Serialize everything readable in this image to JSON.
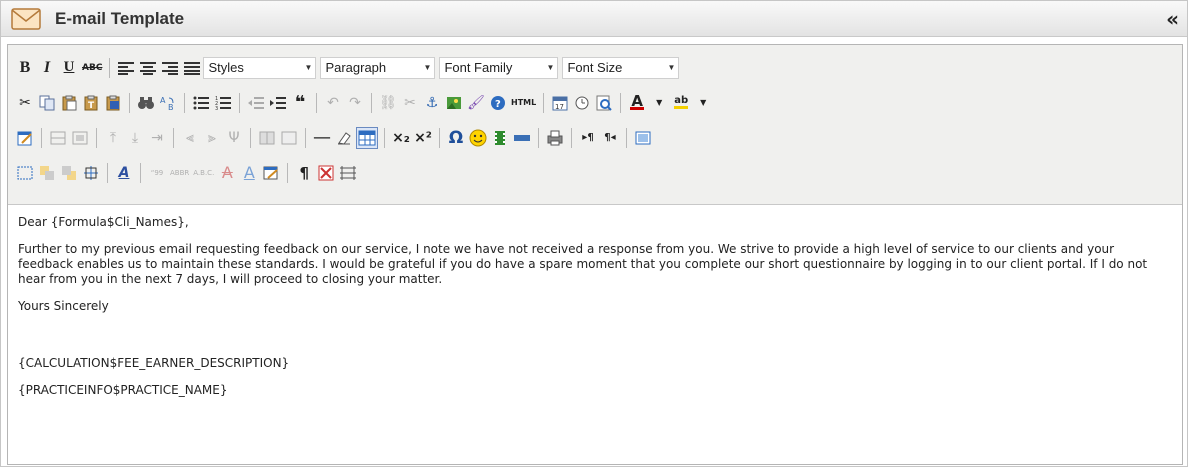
{
  "window": {
    "title": "E-mail Template",
    "collapse_glyph": "«"
  },
  "toolbar": {
    "bold": "B",
    "italic": "I",
    "underline": "U",
    "strikethrough": "ABC",
    "styles": "Styles",
    "paragraph": "Paragraph",
    "font_family": "Font Family",
    "font_size": "Font Size",
    "blockquote": "❝",
    "html": "HTML",
    "font_color": "A",
    "highlight": "ab",
    "subscript": "×₂",
    "superscript": "×²",
    "omega": "Ω",
    "smiley": "☺",
    "print": "⎙",
    "abbr": "ABBR",
    "acronym": "A.B.C.",
    "quote": "“99",
    "pilcrow": "¶",
    "ltr": "▸¶",
    "rtl": "¶◂"
  },
  "content": {
    "greeting": "Dear {Formula$Cli_Names},",
    "body": "Further to my previous email requesting feedback on our service, I note we have not received a response from you.  We strive to provide a high level of service to our clients and your feedback enables us to maintain these standards. I would be grateful if you do have a spare moment that you complete our short questionnaire by logging in to our client portal. If I do not hear from you in the next 7 days, I will proceed to closing your matter.",
    "closing": "Yours Sincerely",
    "fee_earner": "{CALCULATION$FEE_EARNER_DESCRIPTION}",
    "practice": "{PRACTICEINFO$PRACTICE_NAME}"
  }
}
